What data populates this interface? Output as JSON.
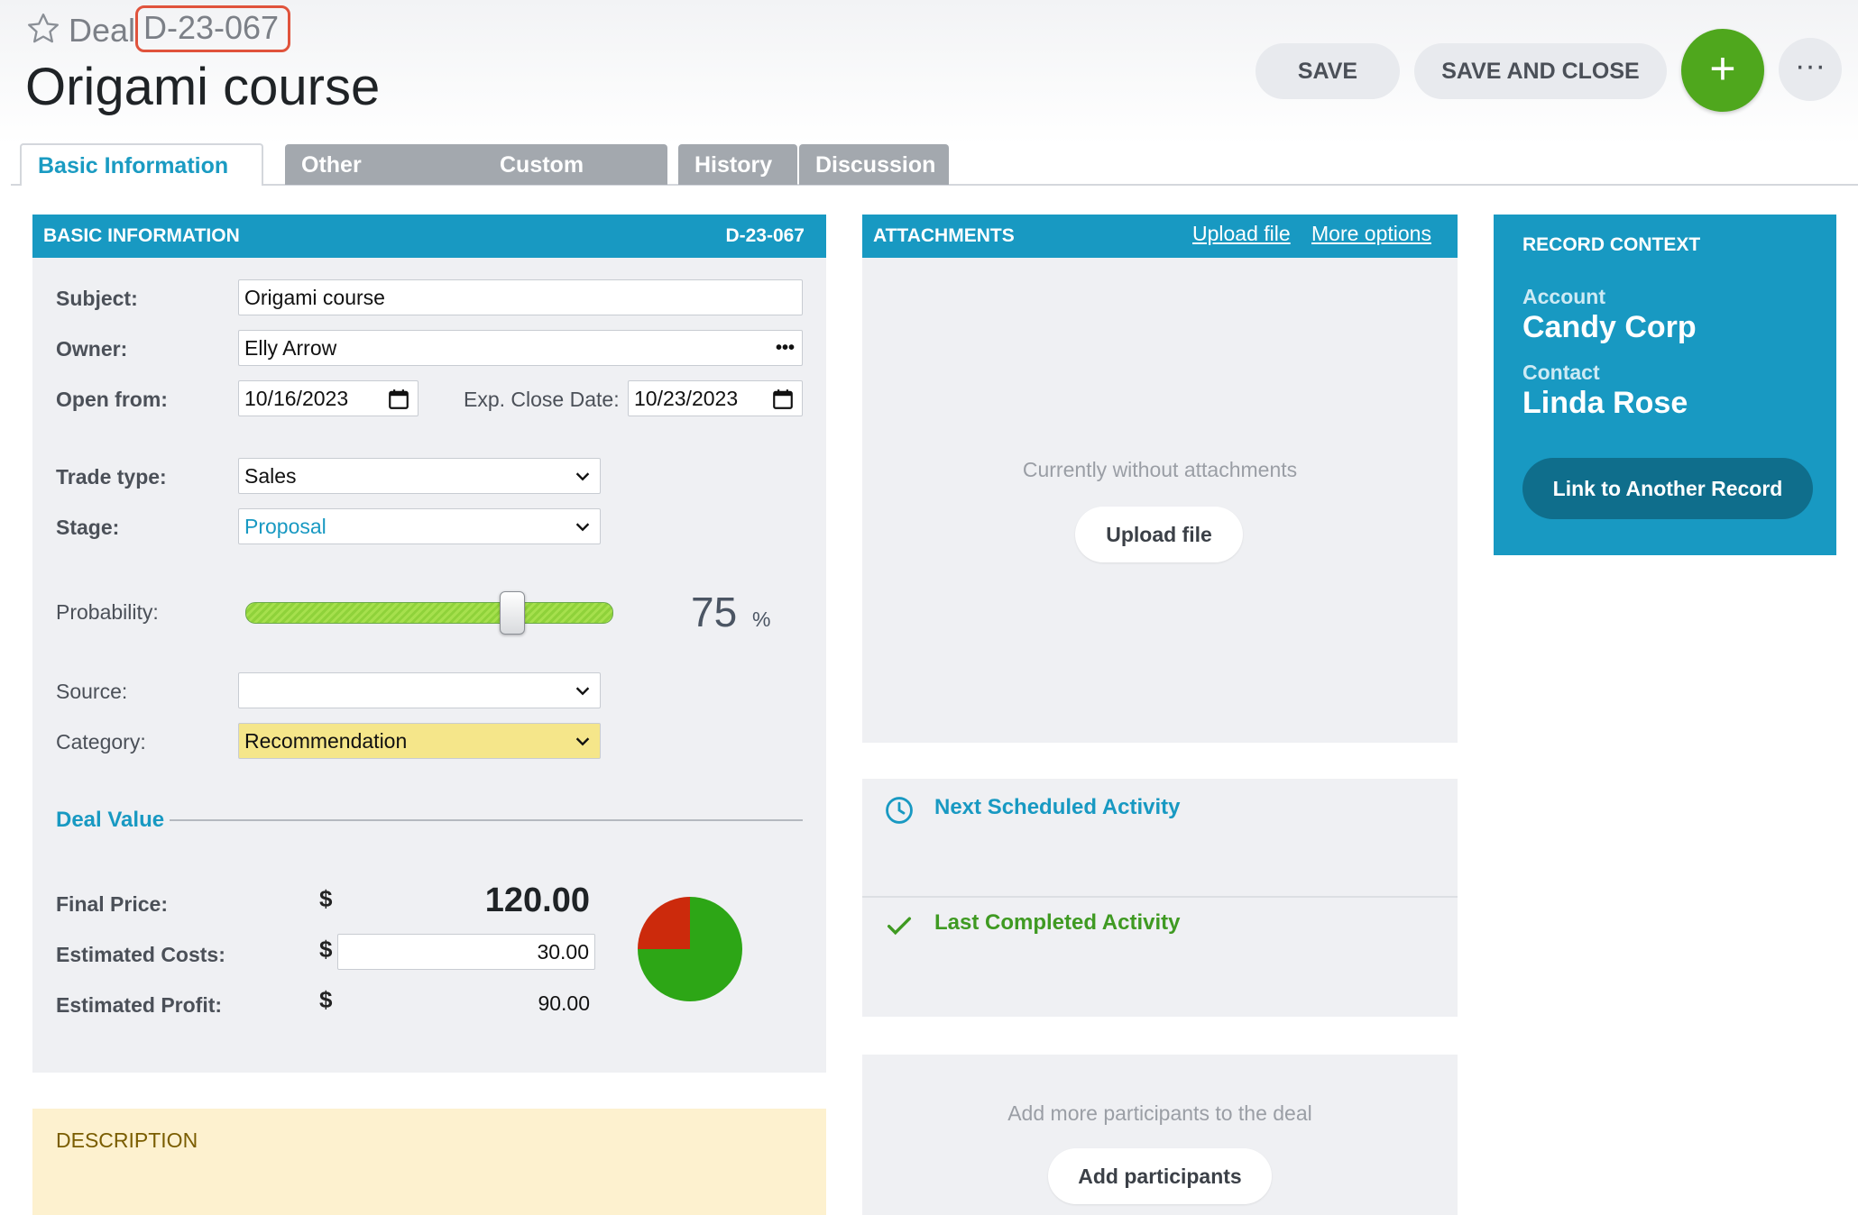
{
  "header": {
    "deal_word": "Deal",
    "deal_id": "D-23-067",
    "title": "Origami course",
    "save_label": "SAVE",
    "save_close_label": "SAVE AND CLOSE",
    "add_label": "+",
    "more_label": "···"
  },
  "tabs": [
    {
      "label": "Basic Information",
      "active": true
    },
    {
      "label": "Other Information"
    },
    {
      "label": "Custom Fields"
    },
    {
      "label": "History"
    },
    {
      "label": "Discussion"
    }
  ],
  "basic": {
    "header": "BASIC INFORMATION",
    "header_id": "D-23-067",
    "subject_label": "Subject:",
    "subject_value": "Origami course",
    "owner_label": "Owner:",
    "owner_value": "Elly Arrow",
    "owner_more": "•••",
    "open_from_label": "Open from:",
    "open_from_value": "10/16/2023",
    "close_label": "Exp. Close Date:",
    "close_value": "10/23/2023",
    "trade_label": "Trade type:",
    "trade_value": "Sales",
    "stage_label": "Stage:",
    "stage_value": "Proposal",
    "prob_label": "Probability:",
    "prob_value": "75",
    "prob_unit": "%",
    "source_label": "Source:",
    "source_value": "",
    "category_label": "Category:",
    "category_value": "Recommendation",
    "deal_value_heading": "Deal Value",
    "final_label": "Final Price:",
    "final_currency": "$",
    "final_value": "120.00",
    "costs_label": "Estimated Costs:",
    "costs_currency": "$",
    "costs_value": "30.00",
    "profit_label": "Estimated Profit:",
    "profit_currency": "$",
    "profit_value": "90.00",
    "pie_colors": {
      "costs": "#cc2a0c",
      "profit": "#2da616"
    }
  },
  "description": {
    "header": "DESCRIPTION"
  },
  "attachments": {
    "header": "ATTACHMENTS",
    "upload_link": "Upload file",
    "more_link": "More options",
    "empty_text": "Currently without attachments",
    "upload_button": "Upload file"
  },
  "activities": {
    "next_label": "Next Scheduled Activity",
    "last_label": "Last Completed Activity"
  },
  "participants": {
    "text": "Add more participants to the deal",
    "button": "Add participants"
  },
  "context": {
    "header": "RECORD CONTEXT",
    "account_label": "Account",
    "account_value": "Candy Corp",
    "contact_label": "Contact",
    "contact_value": "Linda Rose",
    "link_button": "Link to Another Record"
  },
  "colors": {
    "accent": "#1899c2",
    "green": "#4fa71d",
    "highlight": "#f5e68a"
  }
}
